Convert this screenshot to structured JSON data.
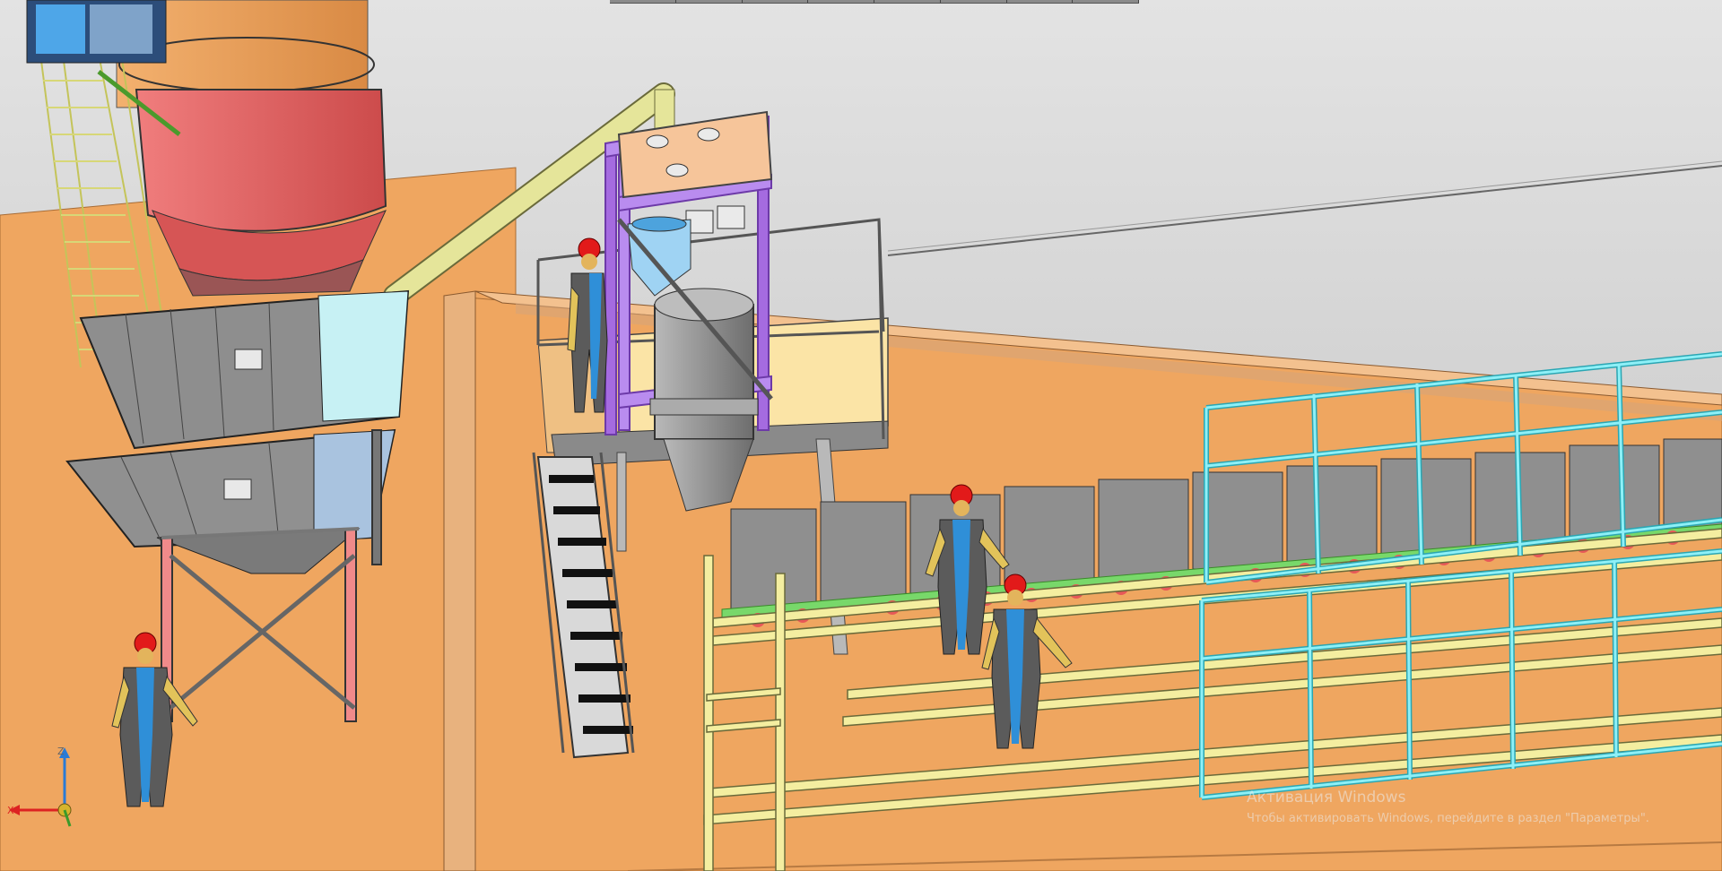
{
  "window": {
    "kind": "3D CAD viewport"
  },
  "toolbar": {
    "segments": 8
  },
  "axis_triad": {
    "z_label": "Z",
    "x_label": "X"
  },
  "watermark": {
    "title": "Активация Windows",
    "subtitle": "Чтобы активировать Windows, перейдите в раздел \"Параметры\"."
  },
  "colors": {
    "background": "#c9c9c9",
    "floor": "#efa660",
    "silo_top": "#f0a55d",
    "silo_band": "#e86a6a",
    "hopper": "#8e8e8e",
    "frame_purple": "#9a5fd8",
    "cyan_frame": "#7fe2ec",
    "rail_yellow": "#f4eea0",
    "worker_blue": "#2f8fd8",
    "helmet_red": "#e21a1a"
  }
}
